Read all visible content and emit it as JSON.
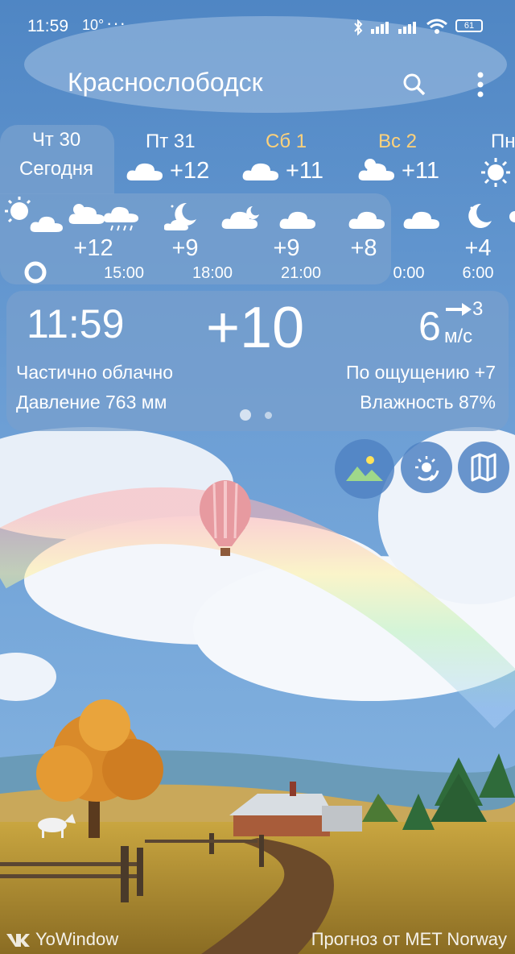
{
  "status_bar": {
    "time": "11:59",
    "temp": "10°",
    "more": "···",
    "battery": "61"
  },
  "header": {
    "city": "Краснослободск"
  },
  "days": [
    {
      "name": "Чт 30",
      "sub": "Сегодня"
    },
    {
      "name": "Пт 31",
      "temp": "+12"
    },
    {
      "name": "Сб 1",
      "temp": "+11"
    },
    {
      "name": "Вс 2",
      "temp": "+11"
    },
    {
      "name": "Пн"
    }
  ],
  "hours": [
    {
      "temp": "+12",
      "time": "15:00"
    },
    {
      "temp": "+9",
      "time": "18:00"
    },
    {
      "temp": "+9",
      "time": "21:00"
    },
    {
      "temp": "+8",
      "time": "0:00"
    },
    {
      "temp": "+4",
      "time": "6:00"
    }
  ],
  "current": {
    "time": "11:59",
    "temp": "+10",
    "wind_speed": "6",
    "wind_gust": "3",
    "wind_unit": "м/с",
    "condition": "Частично облачно",
    "feels_like": "По ощущению +7",
    "pressure": "Давление 763 мм",
    "humidity": "Влажность 87%"
  },
  "colors": {
    "weekend": "#ffd27a",
    "panel": "#78a0cd"
  },
  "footer": {
    "brand": "YoWindow",
    "credit": "Прогноз от MET Norway"
  }
}
